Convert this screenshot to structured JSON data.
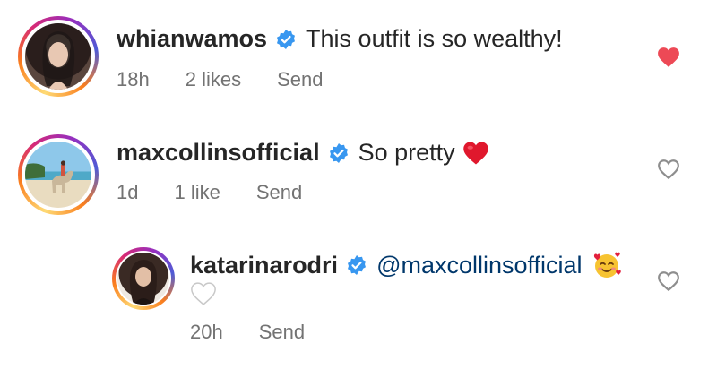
{
  "comments": [
    {
      "username": "whianwamos",
      "text": "This outfit is so wealthy!",
      "time": "18h",
      "likes": "2 likes",
      "send": "Send",
      "liked": true
    },
    {
      "username": "maxcollinsofficial",
      "text": "So pretty",
      "text_emoji": "red-heart",
      "time": "1d",
      "likes": "1 like",
      "send": "Send",
      "liked": false
    },
    {
      "username": "katarinarodri",
      "mention": "@maxcollinsofficial",
      "text_emoji": "smiling-face-with-hearts",
      "second_line_emoji": "white-heart",
      "time": "20h",
      "send": "Send",
      "liked": false
    }
  ],
  "colors": {
    "like_red": "#ed4956",
    "verified_blue": "#3897f0",
    "meta_gray": "#737373",
    "mention_blue": "#00376b"
  }
}
